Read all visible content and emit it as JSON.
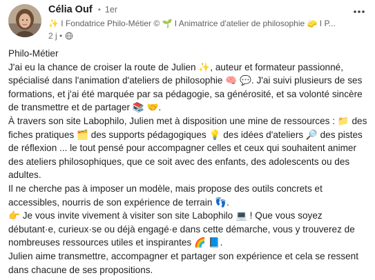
{
  "author": {
    "name": "Célia Ouf",
    "separator": "•",
    "degree": "1er",
    "headline": "✨ I Fondatrice Philo-Métier © 🌱 I Animatrice d'atelier de philosophie 🧽 I P...",
    "timestamp": "2 j •",
    "visibility_icon": "globe-icon"
  },
  "menu": {
    "icon": "more-horizontal-icon"
  },
  "post": {
    "lines": [
      "Philo-Métier",
      "J'ai eu la chance de croiser la route de Julien ✨, auteur et formateur passionné, spécialisé dans l'animation d'ateliers de philosophie 🧠 💬. J'ai suivi plusieurs de ses formations, et j'ai été marquée par sa pédagogie, sa générosité, et sa volonté sincère de transmettre et de partager 📚 🤝.",
      "À travers son site Labophilo, Julien met à disposition une mine de ressources : 📁 des fiches pratiques 🗂️ des supports pédagogiques 💡 des idées d'ateliers 🔎 des pistes de réflexion ... le tout pensé pour accompagner celles et ceux qui souhaitent animer des ateliers philosophiques, que ce soit avec des enfants, des adolescents ou des adultes.",
      "Il ne cherche pas à imposer un modèle, mais propose des outils concrets et accessibles, nourris de son expérience de terrain 👣.",
      "👉 Je vous invite vivement à visiter son site Labophilo 💻 ! Que vous soyez débutant·e, curieux·se ou déjà engagé·e dans cette démarche, vous y trouverez de nombreuses ressources utiles et inspirantes 🌈 📘.",
      "Julien aime transmettre, accompagner et partager son expérience et cela se ressent dans chacune de ses propositions."
    ]
  }
}
